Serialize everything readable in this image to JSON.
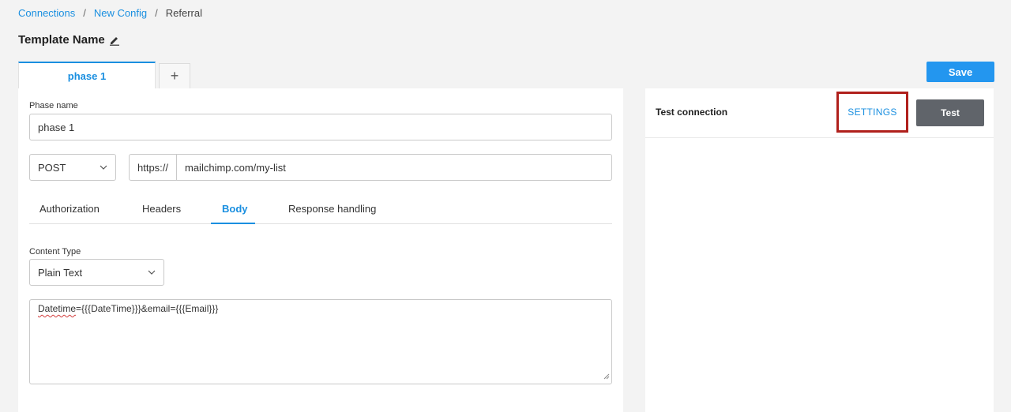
{
  "breadcrumb": {
    "items": [
      "Connections",
      "New Config"
    ],
    "separator": "/",
    "current": "Referral"
  },
  "page": {
    "title": "Template Name"
  },
  "phase_tabs": [
    {
      "label": "phase 1",
      "active": true
    }
  ],
  "add_phase": {
    "label": "+"
  },
  "save_button": {
    "label": "Save"
  },
  "phase_form": {
    "phase_name_label": "Phase name",
    "phase_name_value": "phase 1",
    "method_value": "POST",
    "url_prefix": "https://",
    "url_value": "mailchimp.com/my-list"
  },
  "sub_tabs": [
    {
      "label": "Authorization",
      "active": false
    },
    {
      "label": "Headers",
      "active": false
    },
    {
      "label": "Body",
      "active": true
    },
    {
      "label": "Response handling",
      "active": false
    }
  ],
  "body": {
    "content_type_label": "Content Type",
    "content_type_value": "Plain Text",
    "text_first_word": "Datetime",
    "text_rest": "={{{DateTime}}}&email={{{Email}}}"
  },
  "test_panel": {
    "title": "Test connection",
    "settings_label": "SETTINGS",
    "test_label": "Test"
  },
  "colors": {
    "accent": "#1a8fe0",
    "save": "#2396ef",
    "test_button": "#60646a",
    "highlight_box": "#b0201c"
  }
}
